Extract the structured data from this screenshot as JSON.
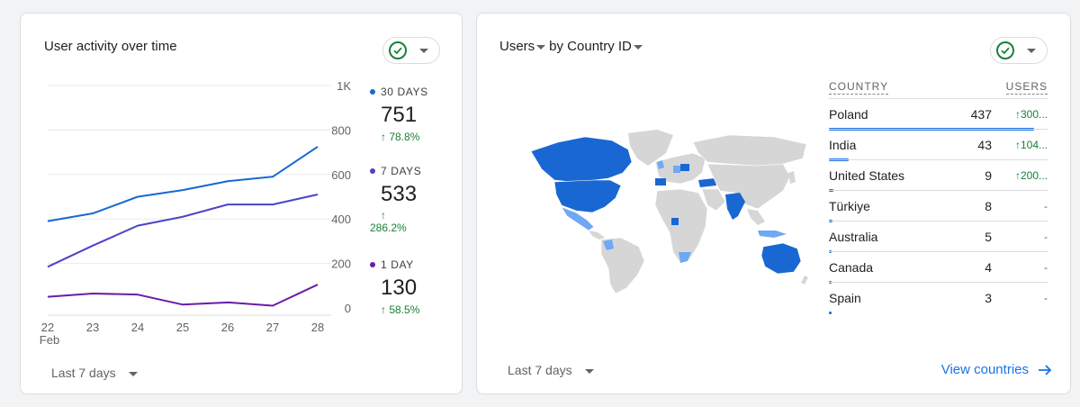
{
  "activity_card": {
    "title": "User activity over time",
    "footer_range": "Last 7 days",
    "legend": [
      {
        "label": "30 DAYS",
        "value": "751",
        "change": "↑ 78.8%",
        "color": "#1967d2"
      },
      {
        "label": "7 DAYS",
        "value": "533",
        "change_arrow": "↑",
        "change_pct": "286.2%",
        "color": "#4b44c7"
      },
      {
        "label": "1 DAY",
        "value": "130",
        "change": "↑ 58.5%",
        "color": "#681da8"
      }
    ]
  },
  "chart_data": {
    "type": "line",
    "title": "User activity over time",
    "x": [
      "22",
      "23",
      "24",
      "25",
      "26",
      "27",
      "28"
    ],
    "x_sublabel": "Feb",
    "y_ticks": [
      "0",
      "200",
      "400",
      "600",
      "800",
      "1K"
    ],
    "ylim": [
      0,
      1000
    ],
    "grid": true,
    "series": [
      {
        "name": "30 DAYS",
        "color": "#1967d2",
        "values": [
          390,
          425,
          500,
          530,
          570,
          590,
          725
        ]
      },
      {
        "name": "7 DAYS",
        "color": "#4b44c7",
        "values": [
          185,
          280,
          370,
          410,
          465,
          465,
          510
        ]
      },
      {
        "name": "1 DAY",
        "color": "#681da8",
        "values": [
          50,
          65,
          60,
          15,
          25,
          10,
          105
        ]
      }
    ]
  },
  "country_card": {
    "title_metric": "Users",
    "title_dimension": "by Country ID",
    "footer_range": "Last 7 days",
    "view_link": "View countries",
    "table": {
      "col_country": "COUNTRY",
      "col_users": "USERS",
      "rows": [
        {
          "country": "Poland",
          "users": "437",
          "change": "↑300...",
          "share": 1.0
        },
        {
          "country": "India",
          "users": "43",
          "change": "↑104...",
          "share": 0.0984
        },
        {
          "country": "United States",
          "users": "9",
          "change": "↑200...",
          "share": 0.0206
        },
        {
          "country": "Türkiye",
          "users": "8",
          "change": "-",
          "share": 0.0183
        },
        {
          "country": "Australia",
          "users": "5",
          "change": "-",
          "share": 0.0114
        },
        {
          "country": "Canada",
          "users": "4",
          "change": "-",
          "share": 0.0092
        },
        {
          "country": "Spain",
          "users": "3",
          "change": "-",
          "share": 0.0069
        }
      ]
    }
  },
  "colors": {
    "accent": "#1a73e8",
    "positive": "#188038",
    "map_dark": "#1967d2",
    "map_light": "#6fa8f5",
    "map_none": "#d6d6d6"
  }
}
